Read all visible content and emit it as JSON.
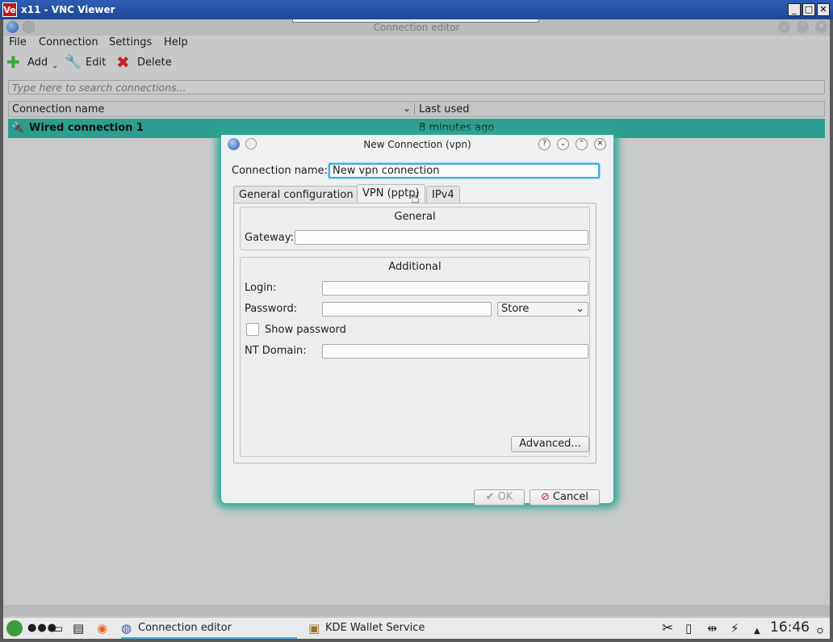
{
  "vnc": {
    "app_icon": "Ve",
    "title": "x11 - VNC Viewer",
    "controls": [
      "_",
      "□",
      "✕"
    ]
  },
  "main_window": {
    "title": "Connection editor",
    "menu": [
      "File",
      "Connection",
      "Settings",
      "Help"
    ],
    "toolbar": {
      "add": "Add",
      "edit": "Edit",
      "delete": "Delete"
    },
    "search_placeholder": "Type here to search connections...",
    "columns": [
      "Connection name",
      "Last used"
    ],
    "rows": [
      {
        "name": "Wired connection 1",
        "last_used": "8 minutes ago"
      }
    ]
  },
  "dialog": {
    "title": "New Connection (vpn)",
    "connection_name_label": "Connection name:",
    "connection_name_value": "New vpn connection",
    "tabs": [
      "General configuration",
      "VPN (pptp)",
      "IPv4"
    ],
    "active_tab": "VPN (pptp)",
    "general_group": {
      "title": "General",
      "gateway_label": "Gateway:",
      "gateway_value": ""
    },
    "additional_group": {
      "title": "Additional",
      "login_label": "Login:",
      "password_label": "Password:",
      "password_store_option": "Store",
      "show_password_label": "Show password",
      "show_password_checked": false,
      "nt_domain_label": "NT Domain:"
    },
    "advanced_button": "Advanced...",
    "ok_button": "OK",
    "cancel_button": "Cancel"
  },
  "taskbar": {
    "tasks": [
      "Connection editor",
      "KDE Wallet Service"
    ],
    "clock": "16:46"
  },
  "colors": {
    "selection": "#2c9e8e",
    "focus": "#3daee9",
    "dialog_glow": "#2fa895"
  }
}
